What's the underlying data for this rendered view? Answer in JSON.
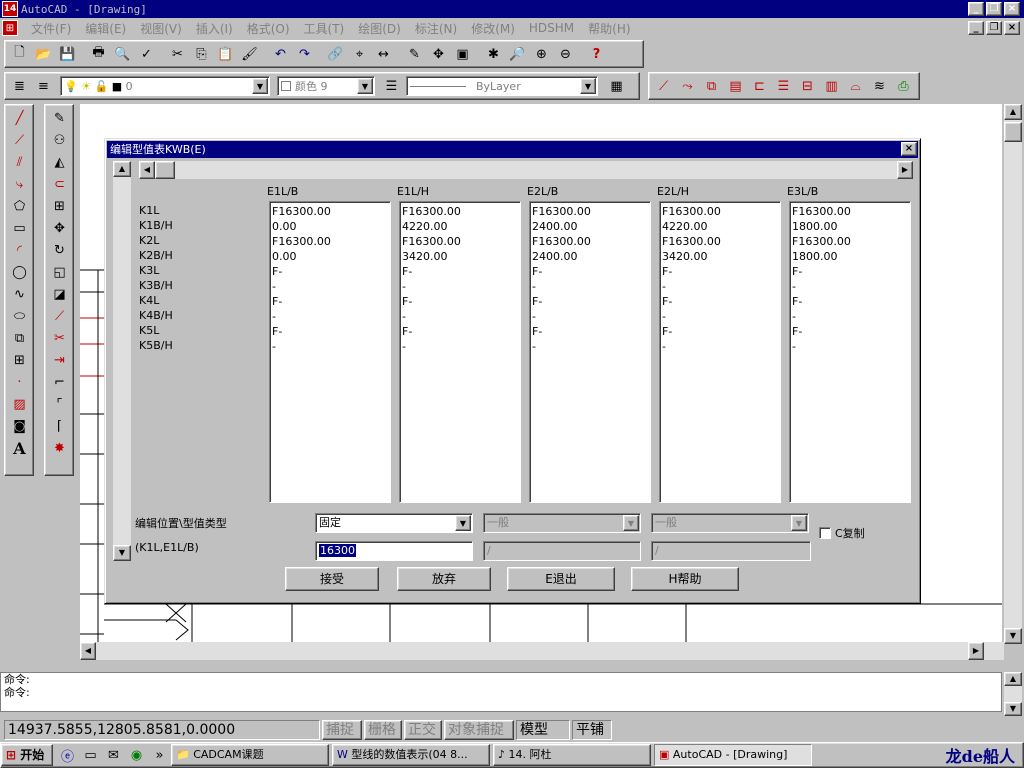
{
  "window": {
    "app_icon_text": "14",
    "title": "AutoCAD - [Drawing]"
  },
  "menu": [
    "文件(F)",
    "编辑(E)",
    "视图(V)",
    "插入(I)",
    "格式(O)",
    "工具(T)",
    "绘图(D)",
    "标注(N)",
    "修改(M)",
    "HDSHM",
    "帮助(H)"
  ],
  "layer_bar": {
    "layer_value": "0",
    "color_value": "颜色 9",
    "linetype_value": "ByLayer"
  },
  "dialog": {
    "title": "编辑型值表KWB(E)",
    "columns": [
      "E1L/B",
      "E1L/H",
      "E2L/B",
      "E2L/H",
      "E3L/B"
    ],
    "row_labels": [
      "K1L",
      "K1B/H",
      "K2L",
      "K2B/H",
      "K3L",
      "K3B/H",
      "K4L",
      "K4B/H",
      "K5L",
      "K5B/H"
    ],
    "cells": [
      [
        "F16300.00",
        "0.00",
        "F16300.00",
        "0.00",
        "F-",
        "-",
        "F-",
        "-",
        "F-",
        "-"
      ],
      [
        "F16300.00",
        "4220.00",
        "F16300.00",
        "3420.00",
        "F-",
        "-",
        "F-",
        "-",
        "F-",
        "-"
      ],
      [
        "F16300.00",
        "2400.00",
        "F16300.00",
        "2400.00",
        "F-",
        "-",
        "F-",
        "-",
        "F-",
        "-"
      ],
      [
        "F16300.00",
        "4220.00",
        "F16300.00",
        "3420.00",
        "F-",
        "-",
        "F-",
        "-",
        "F-",
        "-"
      ],
      [
        "F16300.00",
        "1800.00",
        "F16300.00",
        "1800.00",
        "F-",
        "-",
        "F-",
        "-",
        "F-",
        "-"
      ]
    ],
    "edit_label": "编辑位置\\型值类型",
    "position_label": "(K1L,E1L/B)",
    "type_select": "固定",
    "type_select2": "一般",
    "type_select3": "一般",
    "value_input": "16300",
    "value_input2": "/",
    "value_input3": "/",
    "copy_label": "C复制",
    "buttons": {
      "accept": "接受",
      "discard": "放弃",
      "exit": "E退出",
      "help": "H帮助"
    }
  },
  "command": {
    "line1": "命令:",
    "line2": "命令:"
  },
  "status": {
    "coords": "14937.5855,12805.8581,0.0000",
    "toggles": [
      "捕捉",
      "栅格",
      "正交",
      "对象捕捉",
      "模型",
      "平铺"
    ]
  },
  "taskbar": {
    "start": "开始",
    "tasks": [
      "CADCAM课题",
      "型线的数值表示(04 8...",
      "14. 阿杜",
      "AutoCAD - [Drawing]"
    ],
    "watermark": "龙de船人"
  },
  "colors": {
    "titlebar": "#000080",
    "face": "#c0c0c0",
    "drawing_bg": "#ffffff"
  }
}
